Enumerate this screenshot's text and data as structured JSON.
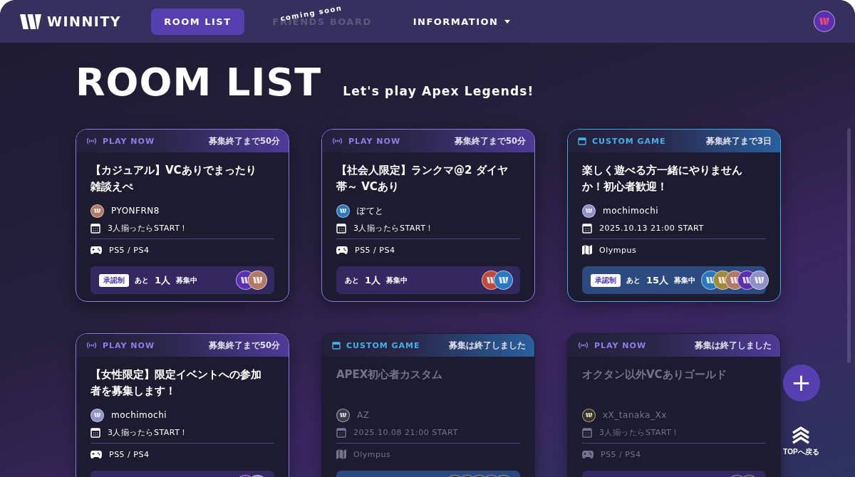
{
  "header": {
    "logo": "WINNITY",
    "nav": [
      {
        "label": "ROOM LIST",
        "selected": true,
        "disabled": false
      },
      {
        "label": "FRIENDS BOARD",
        "selected": false,
        "disabled": true,
        "note": "coming soon"
      },
      {
        "label": "INFORMATION",
        "selected": false,
        "disabled": false,
        "dropdown": true
      }
    ],
    "user_avatar": {
      "color": "#5a2fb0"
    }
  },
  "page": {
    "title": "ROOM LIST",
    "subtitle": "Let's play Apex Legends!"
  },
  "rooms": [
    {
      "kind": "play_now",
      "label": "PLAY NOW",
      "deadline": "募集終了まで50分",
      "closed": false,
      "title": "【カジュアル】VCありでまったり雑談えぺ",
      "host": {
        "name": "PYONFRN8",
        "color": "#b07a66"
      },
      "schedule": "3人揃ったらSTART！",
      "detail": {
        "kind": "platform",
        "text": "PS5 / PS4"
      },
      "approval": "承認制",
      "remaining": {
        "prefix": "あと",
        "count": "1人",
        "suffix": "募集中"
      },
      "avatars": [
        {
          "color": "#5a2fb0"
        },
        {
          "color": "#b07a66"
        }
      ]
    },
    {
      "kind": "play_now",
      "label": "PLAY NOW",
      "deadline": "募集終了まで50分",
      "closed": false,
      "title": "【社会人限定】ランクマ@2 ダイヤ帯～ VCあり",
      "host": {
        "name": "ぽてと",
        "color": "#2a78c0"
      },
      "schedule": "3人揃ったらSTART！",
      "detail": {
        "kind": "platform",
        "text": "PS5 / PS4"
      },
      "remaining": {
        "prefix": "あと",
        "count": "1人",
        "suffix": "募集中"
      },
      "avatars": [
        {
          "color": "#c0493e"
        },
        {
          "color": "#2a78c0"
        }
      ]
    },
    {
      "kind": "custom_game",
      "label": "CUSTOM GAME",
      "deadline": "募集終了まで3日",
      "closed": false,
      "title": "楽しく遊べる方一緒にやりませんか！初心者歓迎！",
      "host": {
        "name": "mochimochi",
        "color": "#8f90c8"
      },
      "schedule": "2025.10.13 21:00 START",
      "detail": {
        "kind": "map",
        "text": "Olympus"
      },
      "approval": "承認制",
      "remaining": {
        "prefix": "あと",
        "count": "15人",
        "suffix": "募集中"
      },
      "avatars": [
        {
          "color": "#2a78c0"
        },
        {
          "color": "#a08a3a"
        },
        {
          "color": "#b07a66"
        },
        {
          "color": "#5a2fb0"
        },
        {
          "color": "#8f90c8"
        }
      ]
    },
    {
      "kind": "play_now",
      "label": "PLAY NOW",
      "deadline": "募集終了まで50分",
      "closed": false,
      "title": "【女性限定】限定イベントへの参加者を募集します！",
      "host": {
        "name": "mochimochi",
        "color": "#8f90c8"
      },
      "schedule": "3人揃ったらSTART！",
      "detail": {
        "kind": "platform",
        "text": "PS5 / PS4"
      },
      "avatars": [
        {
          "color": "#5a2fb0"
        },
        {
          "color": "#8f90c8"
        }
      ]
    },
    {
      "kind": "custom_game",
      "label": "CUSTOM GAME",
      "deadline": "募集は終了しました",
      "closed": true,
      "title": "APEX初心者カスタム",
      "host": {
        "name": "AZ",
        "color": "#3a3a4e"
      },
      "schedule": "2025.10.08 21:00 START",
      "detail": {
        "kind": "map",
        "text": "Olympus"
      },
      "avatars": [
        {
          "color": "#3a3630"
        },
        {
          "color": "#3a3630"
        },
        {
          "color": "#3a3630"
        },
        {
          "color": "#3a2a60"
        },
        {
          "color": "#3a3a4e"
        }
      ]
    },
    {
      "kind": "play_now",
      "label": "PLAY NOW",
      "deadline": "募集は終了しました",
      "closed": true,
      "title": "オクタン以外VCありゴールド",
      "host": {
        "name": "xX_tanaka_Xx",
        "color": "#3a3320"
      },
      "schedule": "3人揃ったらSTART！",
      "detail": {
        "kind": "platform",
        "text": "PS5 / PS4"
      },
      "avatars": [
        {
          "color": "#3a2a60"
        },
        {
          "color": "#3a3a3e"
        }
      ]
    }
  ],
  "fab": {
    "label": "+"
  },
  "back_to_top": {
    "label": "TOPへ戻る"
  }
}
